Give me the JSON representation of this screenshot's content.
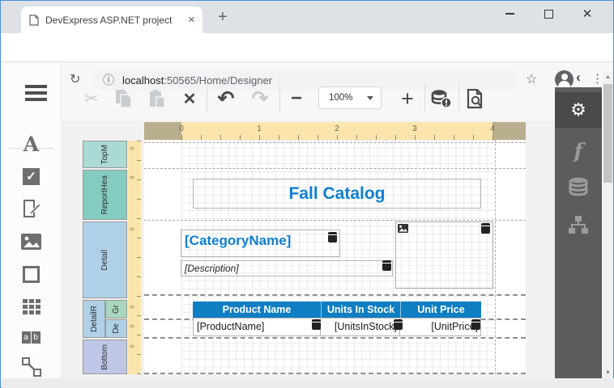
{
  "browser": {
    "tab_title": "DevExpress ASP.NET project",
    "url_host": "localhost",
    "url_rest": ":50565/Home/Designer"
  },
  "icons": {
    "close": "✕",
    "plus": "+",
    "back": "←",
    "forward": "→",
    "reload": "↻",
    "info": "ⓘ",
    "star": "☆",
    "kebab": "⋮",
    "cut": "✂",
    "delete": "✕",
    "undo": "↶",
    "redo": "↷",
    "minus": "−",
    "check": "✓",
    "gear": "⚙",
    "fx": "f",
    "collapse": "‹",
    "up": "▲",
    "down": "▼",
    "label_glyph": "A",
    "comb_a": "a",
    "comb_b": "b"
  },
  "toolbar": {
    "zoom_value": "100%"
  },
  "ruler": {
    "numbers": [
      "0",
      "1",
      "2",
      "3",
      "4"
    ],
    "zero": "0"
  },
  "bands": {
    "top_margin": "TopM",
    "report_header": "ReportHea",
    "detail": "Detail",
    "detail_report": "DetailR",
    "group_header": "Gr",
    "sub_detail": "De",
    "bottom_margin": "Bottom"
  },
  "report": {
    "title": "Fall Catalog",
    "category": "[CategoryName]",
    "description": "[Description]",
    "table": {
      "headers": [
        "Product Name",
        "Units In Stock",
        "Unit Price"
      ],
      "cells": [
        "[ProductName]",
        "[UnitsInStock]",
        "[UnitPrice]"
      ]
    }
  },
  "colors": {
    "accent_blue": "#0E7FD1",
    "table_header_blue": "#0F7EC2",
    "band_teal_light": "#AADAD3",
    "band_teal": "#84CCBF",
    "band_blue": "#B0D0E8",
    "band_green": "#A9D6BF",
    "band_lavender": "#C0C6E6",
    "ruler_light": "#FBE5AC",
    "ruler_dark": "#B9AE8E",
    "panel_dark": "#5C5C5C",
    "window_border": "#4A90D9"
  }
}
